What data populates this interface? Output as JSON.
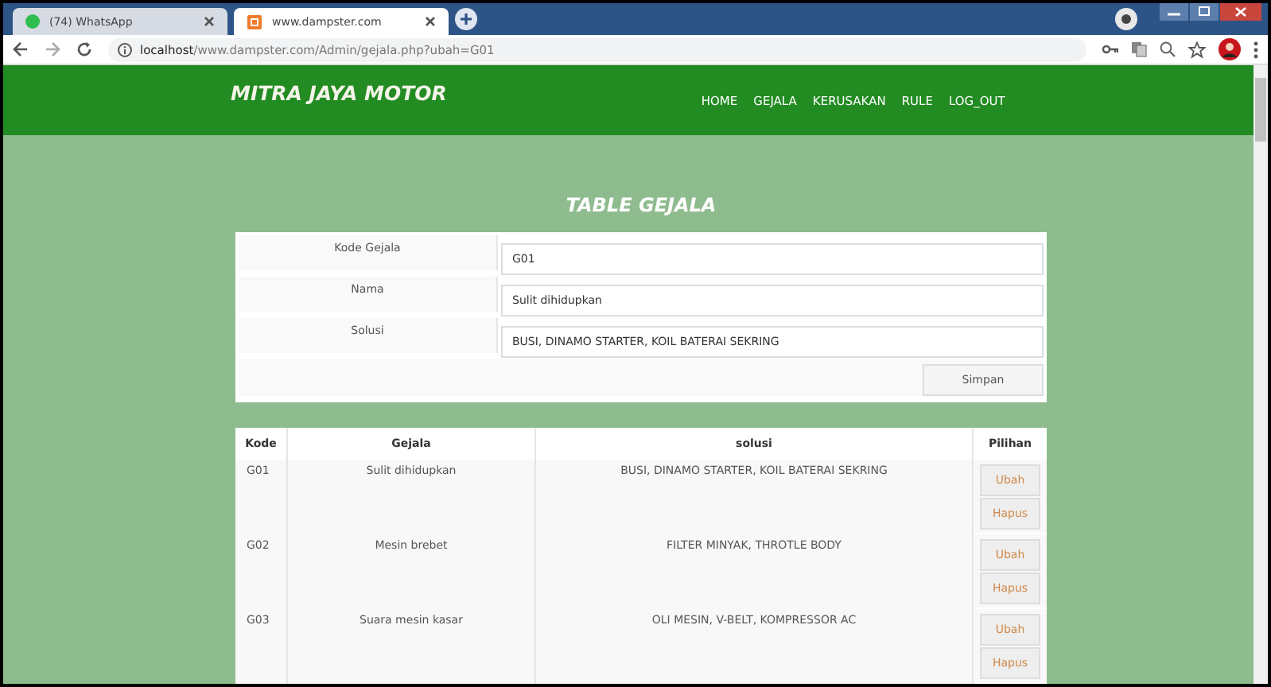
{
  "browser": {
    "tabs": [
      {
        "title": "(74) WhatsApp",
        "kind": "chat",
        "selected": false
      },
      {
        "title": "www.dampster.com",
        "kind": "site",
        "selected": true
      }
    ],
    "url_host": "localhost",
    "url_path": "/www.dampster.com/Admin/gejala.php?ubah=G01"
  },
  "site": {
    "brand": "MITRA JAYA MOTOR",
    "nav": [
      "HOME",
      "GEJALA",
      "KERUSAKAN",
      "RULE",
      "LOG_OUT"
    ]
  },
  "form": {
    "title": "TABLE GEJALA",
    "fields": [
      {
        "label": "Kode Gejala",
        "value": "G01"
      },
      {
        "label": "Nama",
        "value": "Sulit dihidupkan"
      },
      {
        "label": "Solusi",
        "value": "BUSI, DINAMO STARTER, KOIL BATERAI SEKRING"
      }
    ],
    "submit": "Simpan"
  },
  "table": {
    "columns": [
      "Kode",
      "Gejala",
      "solusi",
      "Pilihan"
    ],
    "rows": [
      {
        "kode": "G01",
        "gejala": "Sulit dihidupkan",
        "solusi": "BUSI, DINAMO STARTER, KOIL BATERAI SEKRING",
        "actions": [
          "Ubah",
          "Hapus"
        ]
      },
      {
        "kode": "G02",
        "gejala": "Mesin brebet",
        "solusi": "FILTER MINYAK, THROTLE BODY",
        "actions": [
          "Ubah",
          "Hapus"
        ]
      },
      {
        "kode": "G03",
        "gejala": "Suara mesin kasar",
        "solusi": "OLI MESIN, V-BELT, KOMPRESSOR AC",
        "actions": [
          "Ubah",
          "Hapus"
        ]
      }
    ]
  }
}
